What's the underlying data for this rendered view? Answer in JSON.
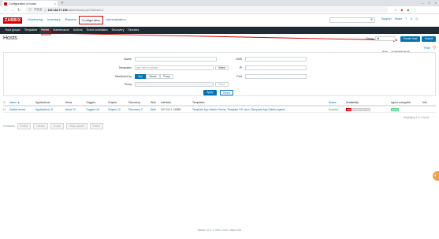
{
  "browser": {
    "tab_title": "Configuration of hosts",
    "security": "不安全",
    "url_host": "192.168.77.153",
    "url_path": "/zabbix/hosts.php?ddreset=1"
  },
  "topnav": {
    "logo": "ZABBIX",
    "menu": [
      "Monitoring",
      "Inventory",
      "Reports",
      "Configuration",
      "Administration"
    ],
    "support": "Support",
    "share": "Share",
    "help": "?"
  },
  "subnav": [
    "Host groups",
    "Templates",
    "Hosts",
    "Maintenance",
    "Actions",
    "Event correlation",
    "Discovery",
    "Services"
  ],
  "page": {
    "title": "Hosts",
    "group_label": "Group",
    "group_value": "all",
    "create_host": "Create host",
    "import": "Import",
    "filter_label": "Filter",
    "annotation": "添加一个监控服务器"
  },
  "filter": {
    "name_label": "Name",
    "templates_label": "Templates",
    "templates_placeholder": "type here to search",
    "select_label": "Select",
    "monitored_by_label": "Monitored by",
    "monitored_by_options": [
      "Any",
      "Server",
      "Proxy"
    ],
    "proxy_label": "Proxy",
    "dns_label": "DNS",
    "ip_label": "IP",
    "port_label": "Port",
    "apply": "Apply",
    "reset": "Reset"
  },
  "table": {
    "headers": [
      "Name ▲",
      "Applications",
      "Items",
      "Triggers",
      "Graphs",
      "Discovery",
      "Web",
      "Interface",
      "Templates",
      "Status",
      "Availability",
      "Agent encryption",
      "Info"
    ],
    "row": {
      "name": "Zabbix server",
      "applications": "Applications 11",
      "items": "Items 70",
      "triggers": "Triggers 44",
      "graphs": "Graphs 12",
      "discovery": "Discovery 2",
      "web": "Web",
      "interface": "127.0.0.1: 10050",
      "templates": "Template App Zabbix Server, Template OS Linux (Template App Zabbix Agent)",
      "status": "Enabled",
      "avail_zbx": "ZBX",
      "avail_other": "SNMP JMX IPMI",
      "encryption": "NONE"
    },
    "displaying": "Displaying 1 of 1 found"
  },
  "mass": {
    "count": "0 selected",
    "buttons": [
      "Enable",
      "Disable",
      "Export",
      "Mass update",
      "Delete"
    ]
  },
  "footer": "Zabbix 4.0.4. © 2001–2019, Zabbix SIA"
}
